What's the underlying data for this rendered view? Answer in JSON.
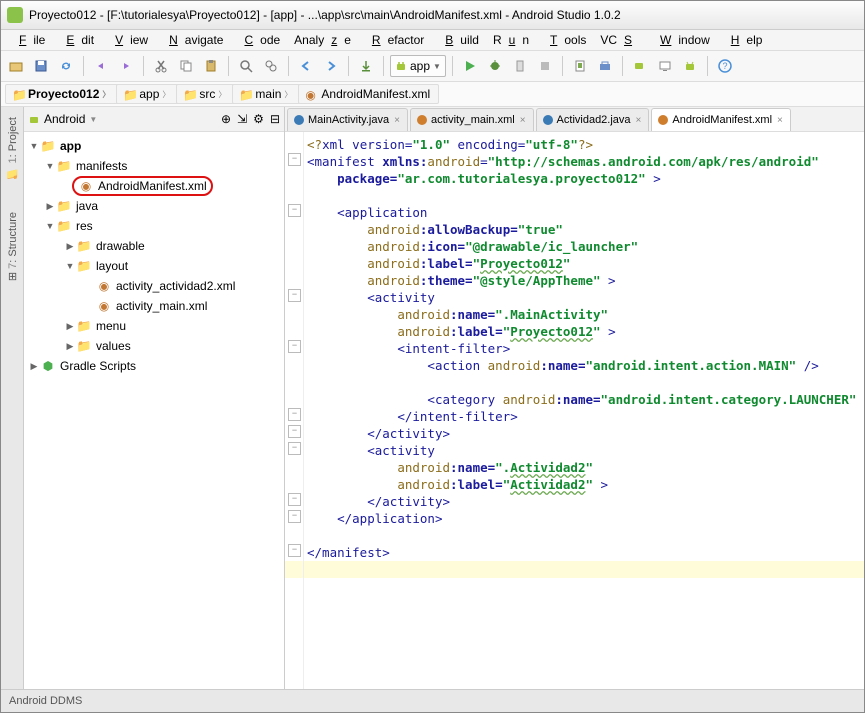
{
  "title": "Proyecto012 - [F:\\tutorialesya\\Proyecto012] - [app] - ...\\app\\src\\main\\AndroidManifest.xml - Android Studio 1.0.2",
  "menu": [
    "File",
    "Edit",
    "View",
    "Navigate",
    "Code",
    "Analyze",
    "Refactor",
    "Build",
    "Run",
    "Tools",
    "VCS",
    "Window",
    "Help"
  ],
  "run_config": "app",
  "breadcrumbs": [
    {
      "label": "Proyecto012",
      "bold": true,
      "icon": "project"
    },
    {
      "label": "app",
      "bold": false,
      "icon": "module"
    },
    {
      "label": "src",
      "bold": false,
      "icon": "folder"
    },
    {
      "label": "main",
      "bold": false,
      "icon": "folder"
    },
    {
      "label": "AndroidManifest.xml",
      "bold": false,
      "icon": "xml"
    }
  ],
  "sidetabs": [
    {
      "num": "1",
      "label": "Project"
    },
    {
      "num": "7",
      "label": "Structure"
    }
  ],
  "projectpane": {
    "selector": "Android"
  },
  "tree": {
    "app": "app",
    "manifests": "manifests",
    "manifest_file": "AndroidManifest.xml",
    "java": "java",
    "res": "res",
    "drawable": "drawable",
    "layout": "layout",
    "layout_files": [
      "activity_actividad2.xml",
      "activity_main.xml"
    ],
    "menu": "menu",
    "values": "values",
    "gradle": "Gradle Scripts"
  },
  "editor_tabs": [
    {
      "label": "MainActivity.java",
      "type": "java",
      "active": false
    },
    {
      "label": "activity_main.xml",
      "type": "xml",
      "active": false
    },
    {
      "label": "Actividad2.java",
      "type": "java",
      "active": false
    },
    {
      "label": "AndroidManifest.xml",
      "type": "xml",
      "active": true
    }
  ],
  "code": {
    "l1_a": "<?",
    "l1_b": "xml version=",
    "l1_c": "\"1.0\"",
    "l1_d": " encoding=",
    "l1_e": "\"utf-8\"",
    "l1_f": "?>",
    "l2_a": "<",
    "l2_b": "manifest ",
    "l2_c": "xmlns:",
    "l2_d": "android",
    "l2_e": "=",
    "l2_f": "\"http://schemas.android.com/apk/res/android\"",
    "l3_a": "package=",
    "l3_b": "\"ar.com.tutorialesya.proyecto012\"",
    "l3_c": " >",
    "l5_a": "<",
    "l5_b": "application",
    "l6_a": "android",
    "l6_b": ":allowBackup=",
    "l6_c": "\"true\"",
    "l7_a": "android",
    "l7_b": ":icon=",
    "l7_c": "\"@drawable/ic_launcher\"",
    "l8_a": "android",
    "l8_b": ":label=",
    "l8_c": "\"",
    "l8_d": "Proyecto012",
    "l8_e": "\"",
    "l9_a": "android",
    "l9_b": ":theme=",
    "l9_c": "\"@style/AppTheme\"",
    "l9_d": " >",
    "l10_a": "<",
    "l10_b": "activity",
    "l11_a": "android",
    "l11_b": ":name=",
    "l11_c": "\".MainActivity\"",
    "l12_a": "android",
    "l12_b": ":label=",
    "l12_c": "\"",
    "l12_d": "Proyecto012",
    "l12_e": "\"",
    "l12_f": " >",
    "l13_a": "<",
    "l13_b": "intent-filter",
    "l13_c": ">",
    "l14_a": "<",
    "l14_b": "action ",
    "l14_c": "android",
    "l14_d": ":name=",
    "l14_e": "\"android.intent.action.MAIN\"",
    "l14_f": " />",
    "l16_a": "<",
    "l16_b": "category ",
    "l16_c": "android",
    "l16_d": ":name=",
    "l16_e": "\"android.intent.category.LAUNCHER\"",
    "l16_f": " />",
    "l17": "</intent-filter>",
    "l18": "</activity>",
    "l19_a": "<",
    "l19_b": "activity",
    "l20_a": "android",
    "l20_b": ":name=",
    "l20_c": "\".",
    "l20_d": "Actividad2",
    "l20_e": "\"",
    "l21_a": "android",
    "l21_b": ":label=",
    "l21_c": "\"",
    "l21_d": "Actividad2",
    "l21_e": "\"",
    "l21_f": " >",
    "l22": "</activity>",
    "l23": "</application>",
    "l25": "</manifest>"
  },
  "status": "Android DDMS"
}
